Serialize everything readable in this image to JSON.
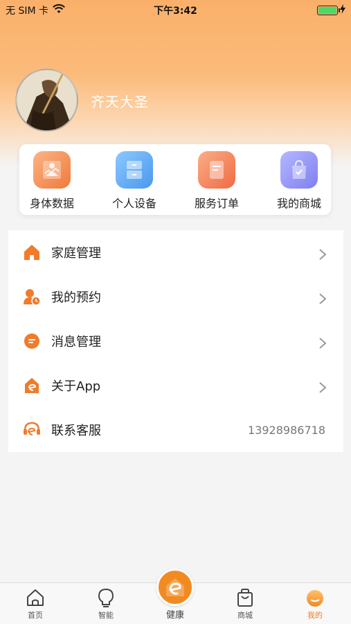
{
  "status_bar": {
    "carrier": "无 SIM 卡",
    "time": "下午3:42",
    "battery_level": 1.0
  },
  "profile": {
    "username": "齐天大圣"
  },
  "quick_actions": [
    {
      "label": "身体数据",
      "icon": "body-data-icon"
    },
    {
      "label": "个人设备",
      "icon": "device-icon"
    },
    {
      "label": "服务订单",
      "icon": "order-icon"
    },
    {
      "label": "我的商城",
      "icon": "shopping-bag-icon"
    }
  ],
  "menu": [
    {
      "label": "家庭管理",
      "icon": "home-icon",
      "chevron": true
    },
    {
      "label": "我的预约",
      "icon": "appointment-icon",
      "chevron": true
    },
    {
      "label": "消息管理",
      "icon": "message-icon",
      "chevron": true
    },
    {
      "label": "关于App",
      "icon": "about-app-icon",
      "chevron": true
    },
    {
      "label": "联系客服",
      "icon": "customer-service-icon",
      "value": "13928986718"
    }
  ],
  "tabs": [
    {
      "label": "首页",
      "icon": "home-tab-icon"
    },
    {
      "label": "智能",
      "icon": "bulb-icon"
    },
    {
      "label": "健康",
      "icon": "health-e-icon"
    },
    {
      "label": "商城",
      "icon": "bag-icon"
    },
    {
      "label": "我的",
      "icon": "profile-face-icon",
      "active": true
    }
  ],
  "colors": {
    "accent": "#f28a22",
    "header_gradient_top": "#fab06a",
    "active_tab": "#f07b2a"
  }
}
